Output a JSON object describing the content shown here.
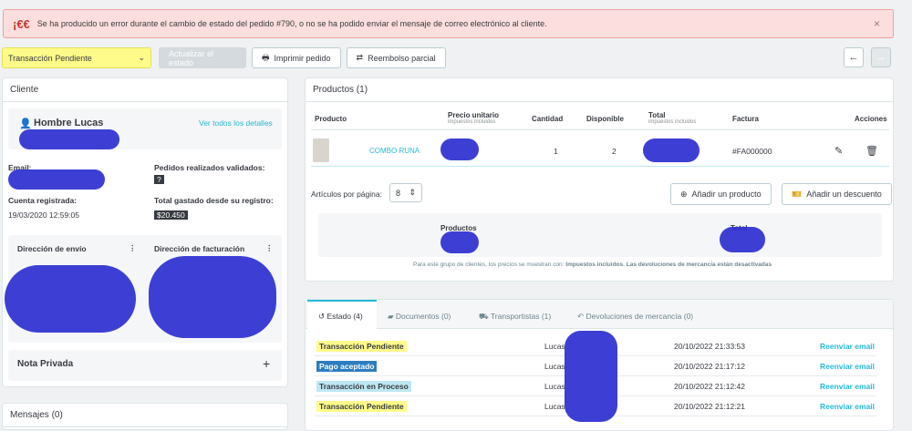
{
  "alert": {
    "icon": "¡€€",
    "message": "Se ha producido un error durante el cambio de estado del pedido #790, o no se ha podido enviar el mensaje de correo electrónico al cliente.",
    "close": "×"
  },
  "toolbar": {
    "status_value": "Transacción Pendiente",
    "update_label": "Actualizar el estado",
    "print_label": "Imprimir pedido",
    "refund_label": "Reembolso parcial"
  },
  "nav": {
    "prev": "←",
    "next": "→"
  },
  "client": {
    "header": "Cliente",
    "name": "Hombre Lucas",
    "details_link": "Ver todos los detalles",
    "email_label": "Email:",
    "orders_label": "Pedidos realizados validados:",
    "orders_count": "?",
    "registered_label": "Cuenta registrada:",
    "registered_value": "19/03/2020 12:59:05",
    "spent_label": "Total gastado desde su registro:",
    "spent_value": "$20.450",
    "shipping_label": "Dirección de envío",
    "billing_label": "Dirección de facturación",
    "private_note_label": "Nota Privada",
    "add": "+"
  },
  "messages": {
    "header": "Mensajes (0)"
  },
  "products": {
    "header": "Productos (1)",
    "columns": {
      "product": "Producto",
      "unit_price": "Precio unitario",
      "unit_price_sub": "impuestos incluidos",
      "quantity": "Cantidad",
      "available": "Disponible",
      "total": "Total",
      "total_sub": "impuestos incluidos",
      "invoice": "Factura",
      "actions": "Acciones"
    },
    "row": {
      "name": "COMBO RUNA",
      "quantity": "1",
      "available": "2",
      "invoice": "#FA000000"
    },
    "per_page_label": "Artículos por página:",
    "per_page_value": "8",
    "add_product": "Añadir un producto",
    "add_discount": "Añadir un descuento",
    "summary_products": "Productos",
    "summary_total": "Total",
    "note_prefix": "Para este grupo de clientes, los precios se muestran con:",
    "note_bold": "Impuestos incluidos. Las devoluciones de mercancía están desactivadas"
  },
  "tabs": [
    {
      "label": "Estado (4)",
      "icon": "history-icon"
    },
    {
      "label": "Documentos (0)",
      "icon": "folder-icon"
    },
    {
      "label": "Transportistas (1)",
      "icon": "truck-icon"
    },
    {
      "label": "Devoluciones de mercancía (0)",
      "icon": "undo-icon"
    }
  ],
  "history": [
    {
      "status": "Transacción Pendiente",
      "style": "yellow",
      "user": "Lucas",
      "date": "20/10/2022 21:33:53",
      "action": "Reenviar email"
    },
    {
      "status": "Pago aceptado",
      "style": "blue",
      "user": "Lucas",
      "date": "20/10/2022 21:17:12",
      "action": "Reenviar email"
    },
    {
      "status": "Transacción en Proceso",
      "style": "cyan",
      "user": "Lucas",
      "date": "20/10/2022 21:12:42",
      "action": "Reenviar email"
    },
    {
      "status": "Transacción Pendiente",
      "style": "yellow",
      "user": "Lucas",
      "date": "20/10/2022 21:12:21",
      "action": "Reenviar email"
    }
  ]
}
